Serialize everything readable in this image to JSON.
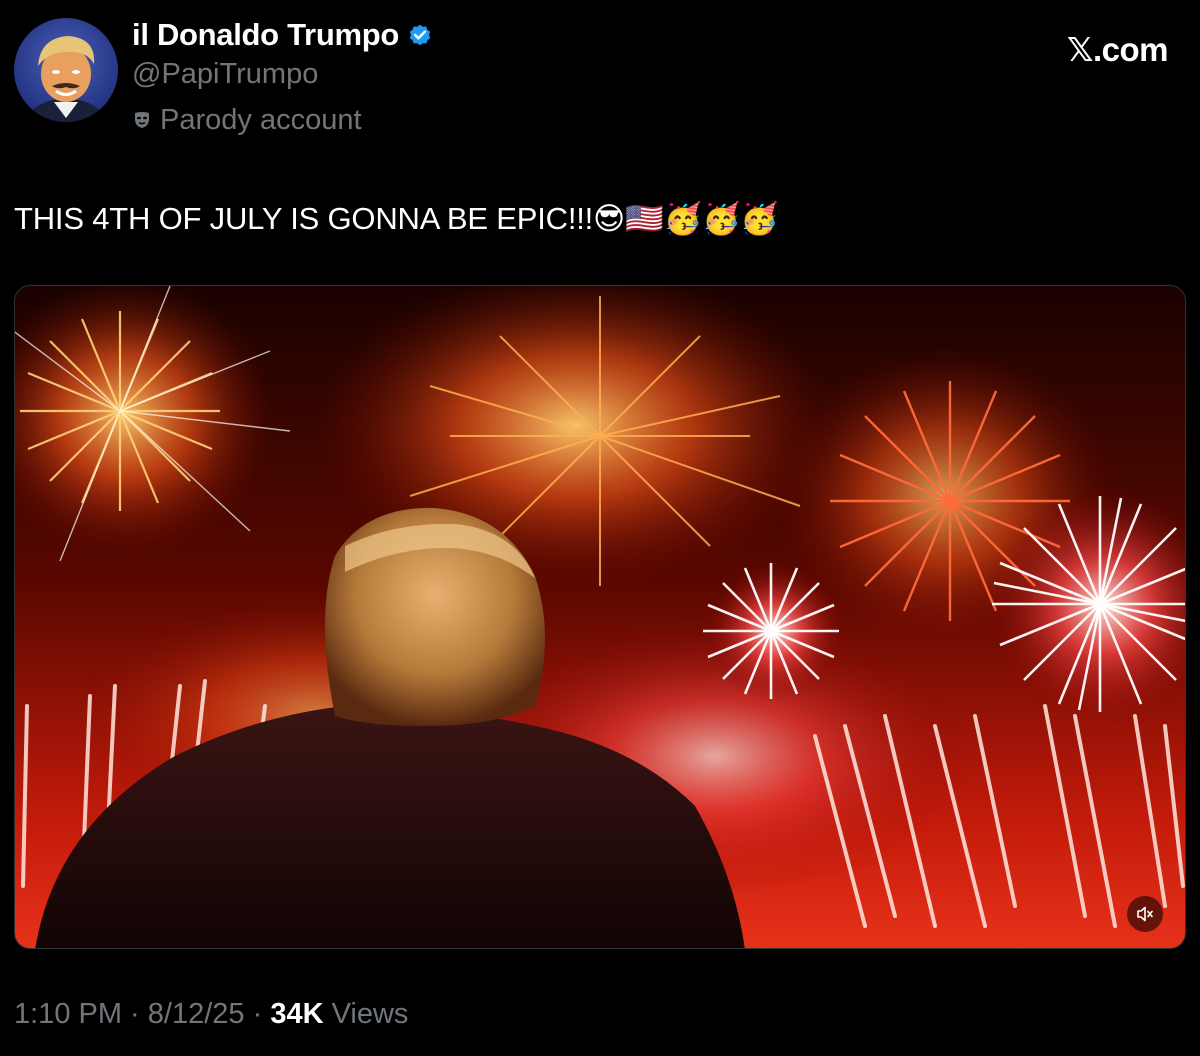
{
  "author": {
    "display_name": "il Donaldo Trumpo",
    "handle": "@PapiTrumpo",
    "label": "Parody account",
    "verified": true
  },
  "brand": {
    "text": ".com"
  },
  "tweet": {
    "text": "THIS 4TH OF JULY IS GONNA BE EPIC!!!😎🇺🇸🥳🥳🥳"
  },
  "meta": {
    "time": "1:10 PM",
    "separator": " · ",
    "date": "8/12/25",
    "views_count": "34K",
    "views_label": "Views"
  },
  "colors": {
    "background": "#000000",
    "text_primary": "#ffffff",
    "text_secondary": "#71767b",
    "verified_blue": "#1d9bf0"
  },
  "icons": {
    "verified": "verified-badge-icon",
    "parody": "parody-mask-icon",
    "mute": "mute-icon"
  }
}
